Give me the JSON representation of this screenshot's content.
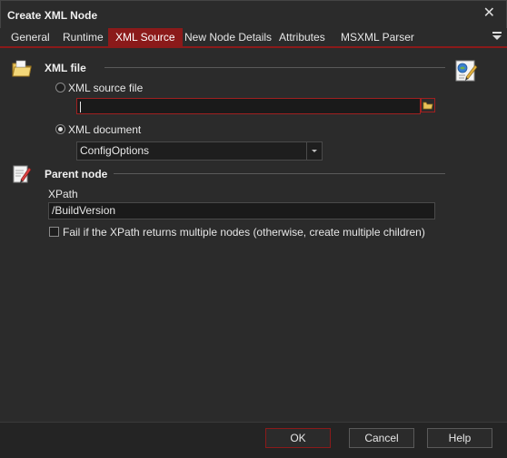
{
  "window": {
    "title": "Create XML Node"
  },
  "tabs": [
    {
      "label": "General"
    },
    {
      "label": "Runtime"
    },
    {
      "label": "XML Source"
    },
    {
      "label": "New Node Details"
    },
    {
      "label": "Attributes"
    },
    {
      "label": "MSXML Parser"
    }
  ],
  "active_tab": "XML Source",
  "xml_file": {
    "heading": "XML file",
    "source_file_label": "XML source file",
    "source_file_value": "",
    "document_label": "XML document",
    "document_selected": "ConfigOptions",
    "selected_option": "XML document"
  },
  "parent_node": {
    "heading": "Parent node",
    "xpath_label": "XPath",
    "xpath_value": "/BuildVersion",
    "fail_label": "Fail if the XPath returns multiple nodes (otherwise, create multiple children)",
    "fail_checked": false
  },
  "footer": {
    "ok": "OK",
    "cancel": "Cancel",
    "help": "Help"
  },
  "colors": {
    "accent": "#8b1a1a",
    "background": "#2b2b2b"
  }
}
